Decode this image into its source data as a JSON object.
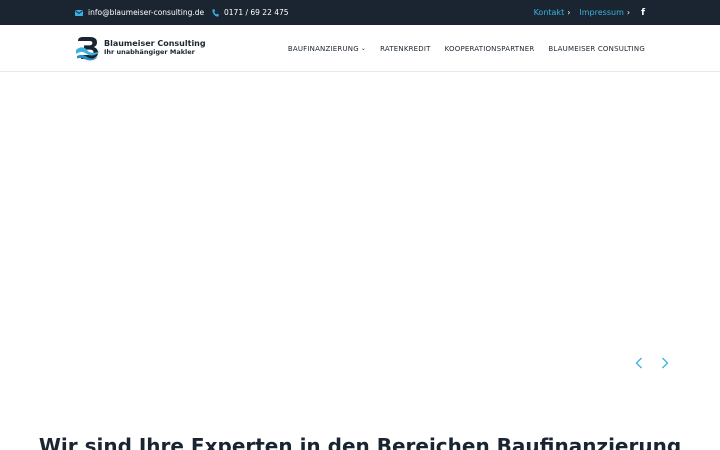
{
  "topbar": {
    "email": "info@blaumeiser-consulting.de",
    "phone": "0171 / 69 22 475",
    "links": [
      {
        "label": "Kontakt"
      },
      {
        "label": "Impressum"
      }
    ],
    "social_icon": "facebook-icon",
    "colors": {
      "background": "#1b2532",
      "accent": "#3ab1df"
    }
  },
  "header": {
    "logo": {
      "name": "Blaumeiser Consulting",
      "tagline": "Ihr unabhängiger Makler"
    },
    "nav": [
      {
        "label": "BAUFINANZIERUNG",
        "has_dropdown": true
      },
      {
        "label": "RATENKREDIT"
      },
      {
        "label": "KOOPERATIONSPARTNER"
      },
      {
        "label": "BLAUMEISER CONSULTING"
      }
    ]
  },
  "slider": {
    "prev_icon": "chevron-left-icon",
    "next_icon": "chevron-right-icon"
  },
  "main": {
    "headline": "Wir sind Ihre Experten in den Bereichen Baufinanzierung"
  }
}
